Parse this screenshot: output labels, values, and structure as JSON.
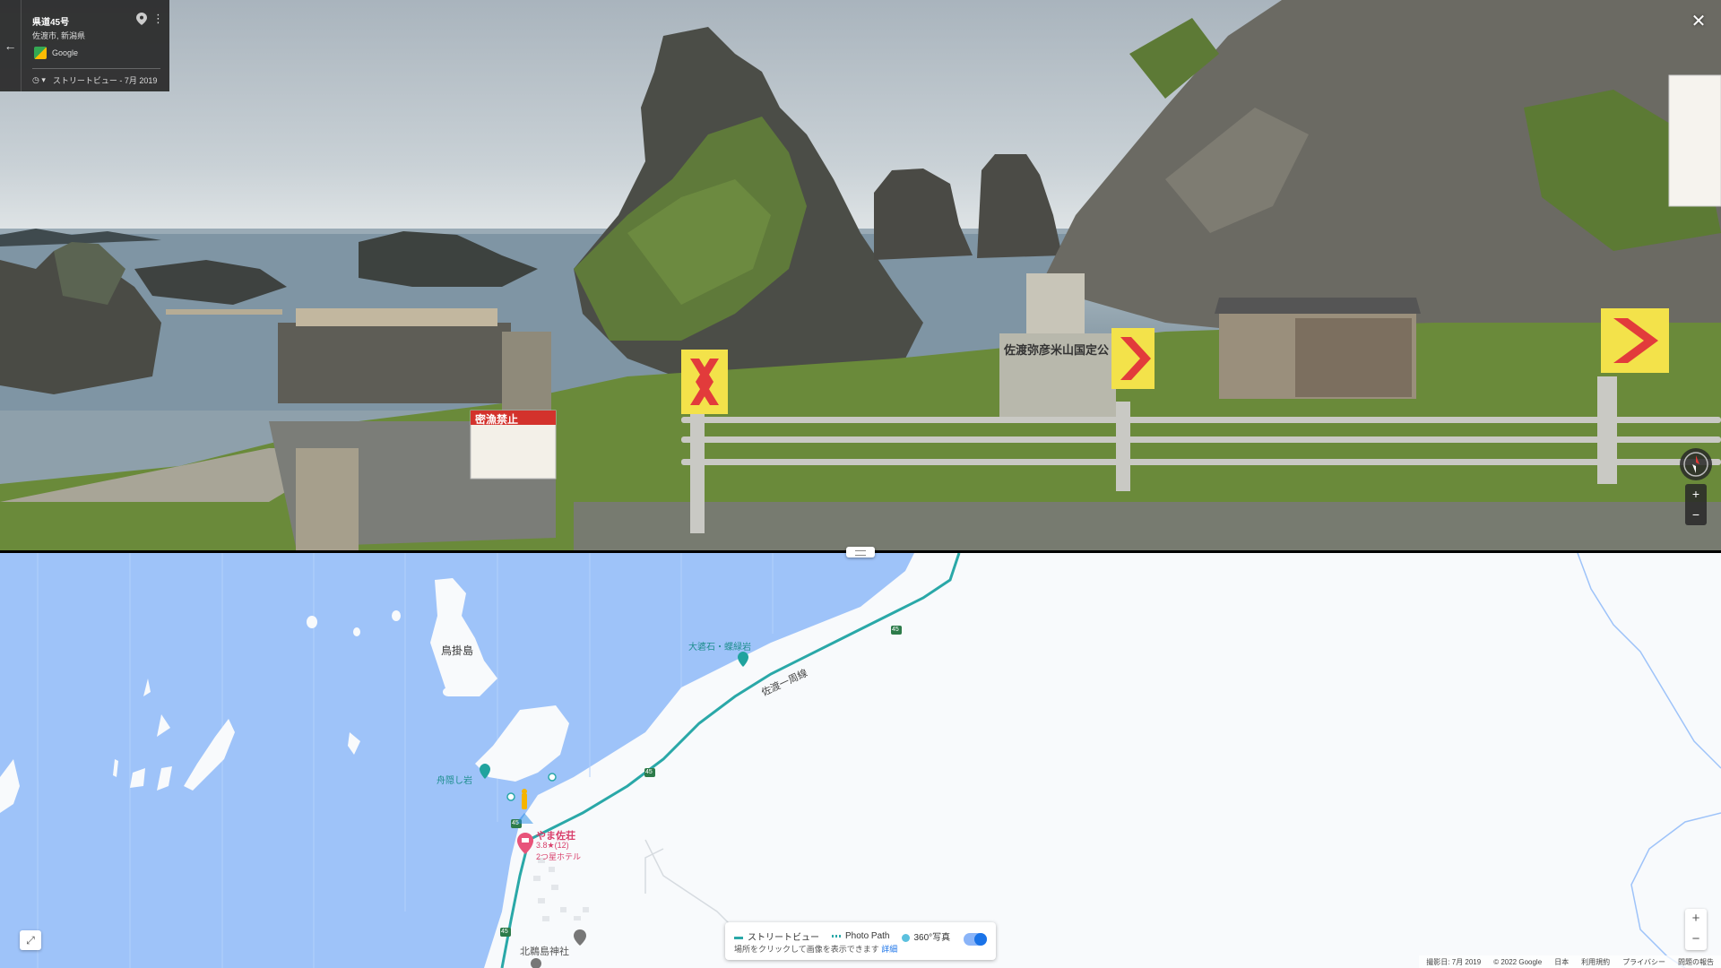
{
  "info_card": {
    "title": "県道45号",
    "location": "佐渡市, 新潟県",
    "brand": "Google",
    "timeline": "ストリートビュー - 7月 2019"
  },
  "signs": {
    "warning_sign_title": "密漁禁止",
    "monument_text": "佐渡弥彦米山国定公"
  },
  "map": {
    "labels": {
      "island": "鳥掛島",
      "poi_1": "大碆石・蝶緑岩",
      "road": "佐渡一周線",
      "poi_2": "舟隠し岩",
      "hotel_name": "やま佐荘",
      "hotel_rating": "3.8★(12)",
      "hotel_type": "2つ星ホテル",
      "shrine": "北鵜島神社"
    },
    "route_numbers": [
      "45",
      "45",
      "45",
      "45"
    ],
    "legend": {
      "streetview": "ストリートビュー",
      "photopath": "Photo Path",
      "photo360": "360°写真",
      "hint": "場所をクリックして画像を表示できます",
      "hint_link": "詳細"
    },
    "footer": {
      "capture": "撮影日: 7月 2019",
      "copyright": "© 2022 Google",
      "country": "日本",
      "terms": "利用規約",
      "privacy": "プライバシー",
      "report": "問題の報告"
    },
    "colors": {
      "water": "#9ec3f9",
      "land": "#f8fafc",
      "route": "#2aa8a8",
      "hotel": "#e8537a"
    }
  }
}
